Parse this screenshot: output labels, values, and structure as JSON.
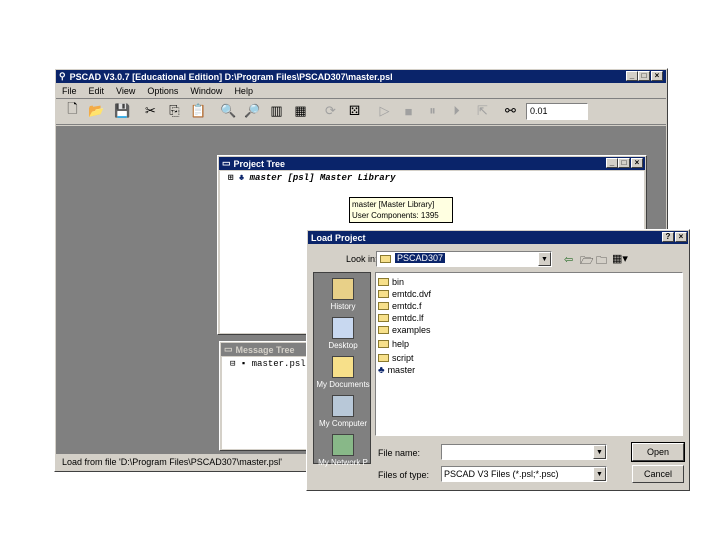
{
  "main": {
    "title": "PSCAD V3.0.7 [Educational Edition] D:\\Program Files\\PSCAD307\\master.psl",
    "menu": [
      "File",
      "Edit",
      "View",
      "Options",
      "Window",
      "Help"
    ],
    "time_field": "0.01",
    "status": "Load from file 'D:\\Program Files\\PSCAD307\\master.psl'"
  },
  "project_tree": {
    "title": "Project Tree",
    "root": "master [psl] Master Library",
    "tooltip": [
      "master [Master Library]",
      "User Components: 1395"
    ]
  },
  "message_tree": {
    "title": "Message Tree",
    "item": "master.psl"
  },
  "dialog": {
    "title": "Load Project",
    "look_in_label": "Look in:",
    "look_in_value": "PSCAD307",
    "places": [
      "History",
      "Desktop",
      "My Documents",
      "My Computer",
      "My Network P"
    ],
    "files": [
      {
        "name": "bin",
        "type": "folder"
      },
      {
        "name": "emtdc.dvf",
        "type": "folder"
      },
      {
        "name": "emtdc.f",
        "type": "folder"
      },
      {
        "name": "emtdc.lf",
        "type": "folder"
      },
      {
        "name": "examples",
        "type": "folder"
      },
      {
        "name": "help",
        "type": "folder"
      },
      {
        "name": "script",
        "type": "folder"
      },
      {
        "name": "master",
        "type": "file"
      }
    ],
    "filename_label": "File name:",
    "filename_value": "",
    "filetype_label": "Files of type:",
    "filetype_value": "PSCAD V3 Files (*.psl;*.psc)",
    "open_label": "Open",
    "cancel_label": "Cancel"
  },
  "colors": {
    "titlebar_active": "#0a246a",
    "window_face": "#d4d0c8",
    "workspace": "#808080",
    "places_bar": "#808080"
  }
}
